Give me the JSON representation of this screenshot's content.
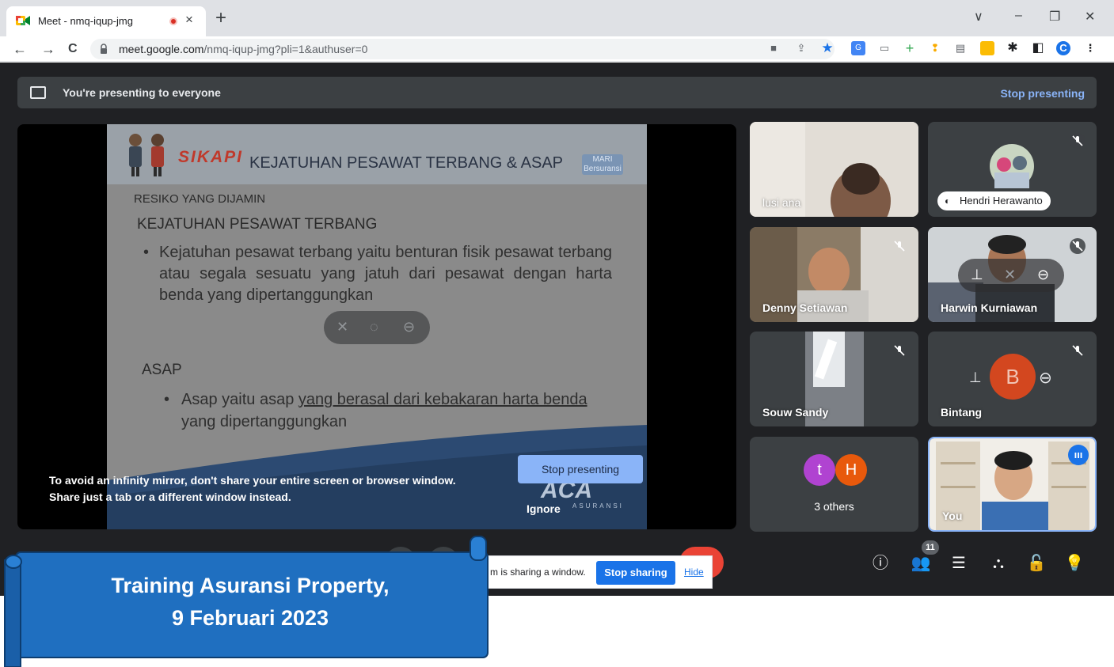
{
  "browser": {
    "tab_title": "Meet - nmq-iqup-jmg",
    "tab_close": "×",
    "new_tab": "+",
    "url_host": "meet.google.com",
    "url_path": "/nmq-iqup-jmg?pli=1&authuser=0",
    "profile_initial": "C",
    "window_controls": [
      "∨",
      "–",
      "❐",
      "✕"
    ],
    "nav": [
      "←",
      "→",
      "C"
    ]
  },
  "presenting_banner": {
    "text": "You're presenting to everyone",
    "stop_label": "Stop presenting"
  },
  "slide": {
    "brand": "SIKAPI",
    "title": "KEJATUHAN PESAWAT  TERBANG & ASAP",
    "logo_right": "MARI Bersuransi",
    "subtitle": "RESIKO YANG DIJAMIN",
    "section1_heading": "KEJATUHAN PESAWAT TERBANG",
    "section1_bullet": "Kejatuhan pesawat terbang yaitu benturan fisik pesawat terbang atau segala sesuatu yang jatuh dari pesawat dengan harta benda yang dipertanggungkan",
    "section2_heading": "ASAP",
    "section2_bullet_a": "Asap yaitu asap ",
    "section2_bullet_b": "yang berasal dari kebakaran harta benda",
    "section2_bullet_c": " yang dipertanggungkan",
    "footer_logo": "ACA",
    "footer_logo_sub": "ASURANSI"
  },
  "warning": {
    "line1": "To avoid an infinity mirror, don't share your entire screen or browser window.",
    "line2": "Share just a tab or a different window instead.",
    "stop_presenting": "Stop presenting",
    "ignore": "Ignore"
  },
  "participants": [
    {
      "name": "lusi ana"
    },
    {
      "name": "Hendri Herawanto"
    },
    {
      "name": "Denny Setiawan"
    },
    {
      "name": "Harwin Kurniawan"
    },
    {
      "name": "Souw Sandy"
    },
    {
      "name": "Bintang",
      "initial": "B"
    },
    {
      "name": "3 others",
      "initials": [
        "t",
        "H"
      ]
    },
    {
      "name": "You"
    }
  ],
  "controls": {
    "participant_count": "11"
  },
  "share_notice": {
    "text": "m is sharing a window.",
    "stop_sharing": "Stop sharing",
    "hide": "Hide"
  },
  "overlay_banner": {
    "line1": "Training Asuransi Property,",
    "line2": "9 Februari 2023"
  },
  "colors": {
    "meet_bg": "#202124",
    "accent_blue": "#8ab4f8",
    "banner_blue": "#1f6fc0",
    "end_call_red": "#ea4335"
  }
}
